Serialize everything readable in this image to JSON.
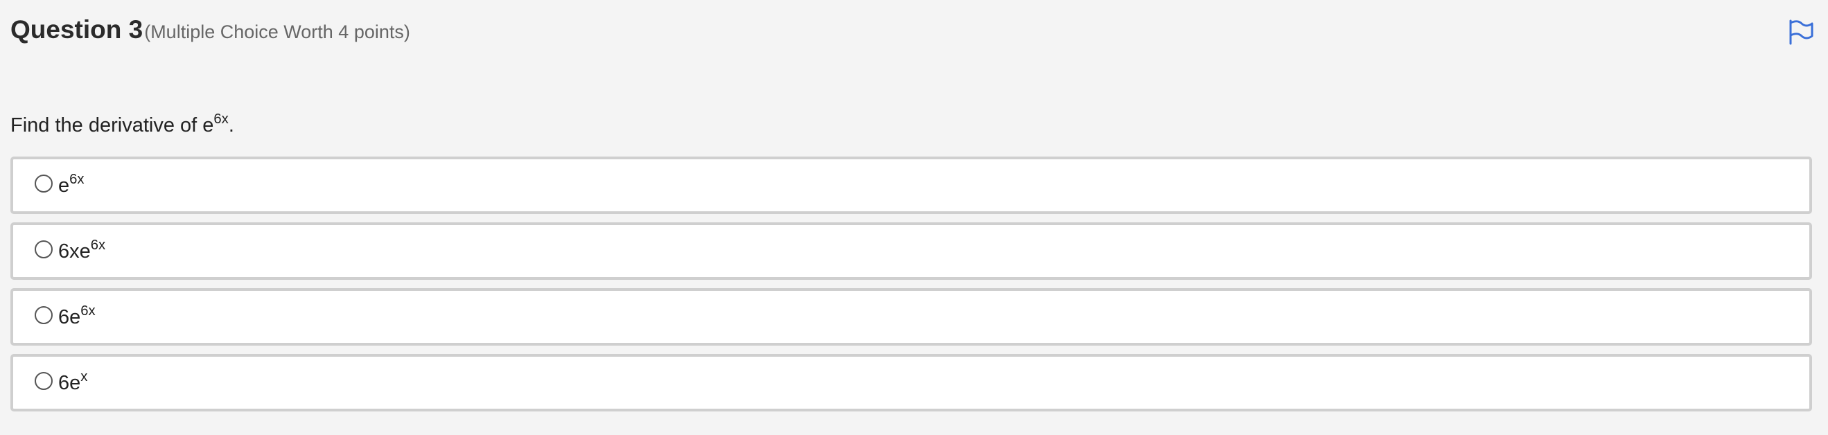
{
  "question": {
    "title": "Question 3",
    "meta": "(Multiple Choice Worth 4 points)",
    "prompt_before": "Find the derivative of e",
    "prompt_sup": "6x",
    "prompt_after": "."
  },
  "flag": {
    "icon": "flag-icon",
    "color": "#3a6fd8"
  },
  "options": [
    {
      "base": "e",
      "sup": "6x"
    },
    {
      "base": "6xe",
      "sup": "6x"
    },
    {
      "base": "6e",
      "sup": "6x"
    },
    {
      "base": "6e",
      "sup": "x"
    }
  ]
}
